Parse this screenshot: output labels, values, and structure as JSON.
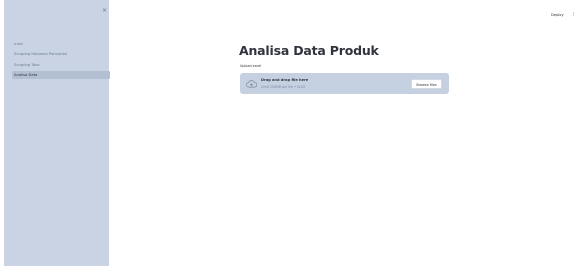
{
  "sidebar": {
    "close_symbol": "×",
    "items": [
      {
        "label": "main",
        "active": false
      },
      {
        "label": "Scraping Halaman Pencarian",
        "active": false
      },
      {
        "label": "Scraping Toko",
        "active": false
      },
      {
        "label": "Analisa Data",
        "active": true
      }
    ]
  },
  "header": {
    "deploy_label": "Deploy",
    "menu_symbol": "⋮"
  },
  "main": {
    "title": "Analisa Data Produk",
    "uploader": {
      "label": "Upload excel",
      "instruction": "Drag and drop file here",
      "limit_text": "Limit 200MB per file • XLSX",
      "browse_label": "Browse files",
      "icon": "cloud-upload-icon"
    }
  },
  "colors": {
    "sidebar_bg": "#c9d3e3",
    "active_item_bg": "#b3c0d4",
    "dropzone_bg": "#c5d0e1",
    "text": "#31333f",
    "muted_text": "#6d7a92"
  }
}
